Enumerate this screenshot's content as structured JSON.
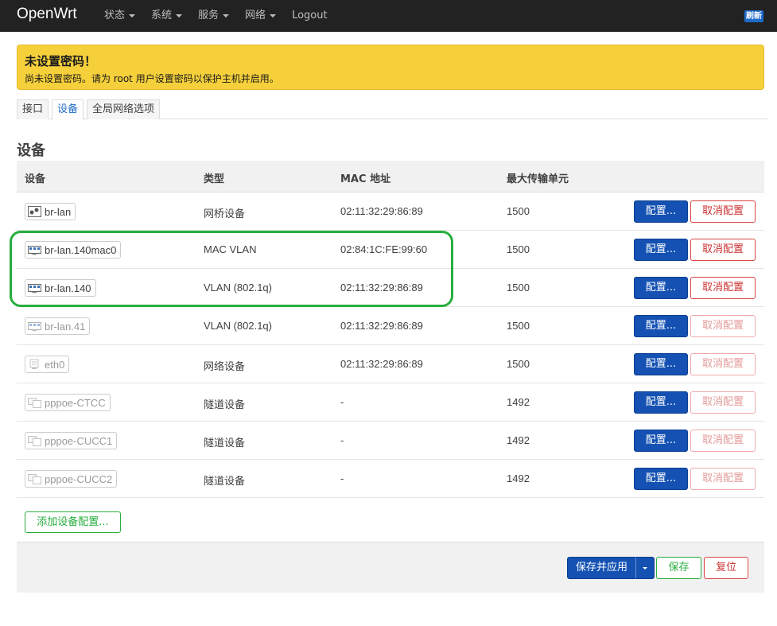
{
  "navbar": {
    "brand": "OpenWrt",
    "menu": [
      {
        "label": "状态",
        "caret": true
      },
      {
        "label": "系统",
        "caret": true
      },
      {
        "label": "服务",
        "caret": true
      },
      {
        "label": "网络",
        "caret": true
      },
      {
        "label": "Logout",
        "caret": false
      }
    ],
    "refresh_label": "刷新"
  },
  "alert": {
    "title": "未设置密码！",
    "text": "尚未设置密码。请为 root 用户设置密码以保护主机并启用。"
  },
  "tabs": [
    {
      "label": "接口",
      "active": false
    },
    {
      "label": "设备",
      "active": true
    },
    {
      "label": "全局网络选项",
      "active": false
    }
  ],
  "section_title": "设备",
  "table": {
    "headers": {
      "device": "设备",
      "type": "类型",
      "mac": "MAC 地址",
      "mtu": "最大传输单元"
    },
    "rows": [
      {
        "device": "br-lan",
        "icon": "bridge-icon",
        "dim": false,
        "type": "网桥设备",
        "mac": "02:11:32:29:86:89",
        "mtu": "1500",
        "configure": "配置...",
        "unconfigure": "取消配置",
        "unconfigure_enabled": true
      },
      {
        "device": "br-lan.140mac0",
        "icon": "vlan-icon",
        "dim": false,
        "type": "MAC VLAN",
        "mac": "02:84:1C:FE:99:60",
        "mtu": "1500",
        "configure": "配置...",
        "unconfigure": "取消配置",
        "unconfigure_enabled": true
      },
      {
        "device": "br-lan.140",
        "icon": "vlan-icon",
        "dim": false,
        "type": "VLAN (802.1q)",
        "mac": "02:11:32:29:86:89",
        "mtu": "1500",
        "configure": "配置...",
        "unconfigure": "取消配置",
        "unconfigure_enabled": true
      },
      {
        "device": "br-lan.41",
        "icon": "vlan-icon",
        "dim": true,
        "type": "VLAN (802.1q)",
        "mac": "02:11:32:29:86:89",
        "mtu": "1500",
        "configure": "配置...",
        "unconfigure": "取消配置",
        "unconfigure_enabled": false
      },
      {
        "device": "eth0",
        "icon": "ethernet-icon",
        "dim": true,
        "type": "网络设备",
        "mac": "02:11:32:29:86:89",
        "mtu": "1500",
        "configure": "配置...",
        "unconfigure": "取消配置",
        "unconfigure_enabled": false
      },
      {
        "device": "pppoe-CTCC",
        "icon": "tunnel-icon",
        "dim": true,
        "type": "隧道设备",
        "mac": "-",
        "mtu": "1492",
        "configure": "配置...",
        "unconfigure": "取消配置",
        "unconfigure_enabled": false
      },
      {
        "device": "pppoe-CUCC1",
        "icon": "tunnel-icon",
        "dim": true,
        "type": "隧道设备",
        "mac": "-",
        "mtu": "1492",
        "configure": "配置...",
        "unconfigure": "取消配置",
        "unconfigure_enabled": false
      },
      {
        "device": "pppoe-CUCC2",
        "icon": "tunnel-icon",
        "dim": true,
        "type": "隧道设备",
        "mac": "-",
        "mtu": "1492",
        "configure": "配置...",
        "unconfigure": "取消配置",
        "unconfigure_enabled": false
      }
    ]
  },
  "add_device_label": "添加设备配置...",
  "footer": {
    "apply_label": "保存并应用",
    "save_label": "保存",
    "reset_label": "复位"
  },
  "colors": {
    "primary": "#1451b3",
    "success": "#27ae3e",
    "danger": "#cc3333",
    "warning": "#f5d03b",
    "navbar": "#222222"
  }
}
